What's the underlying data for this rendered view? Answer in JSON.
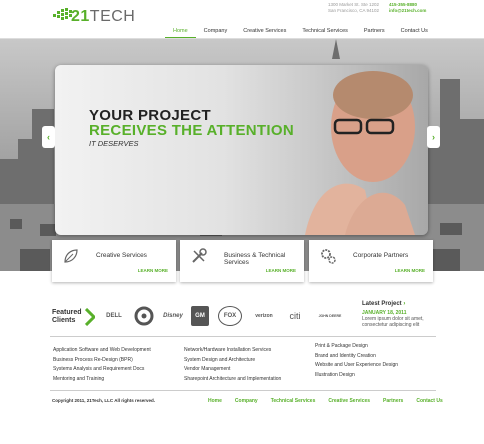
{
  "header": {
    "logo_prefix": "21",
    "logo_suffix": "TECH",
    "address_line1": "1300 Market St. Ste 1202",
    "address_line2": "San Francisco, CA 94102",
    "phone": "415-355-8880",
    "email": "info@21tech.com"
  },
  "nav": [
    "Home",
    "Company",
    "Creative Services",
    "Technical Services",
    "Partners",
    "Contact Us"
  ],
  "hero": {
    "headline1": "YOUR PROJECT",
    "headline2": "RECEIVES THE ATTENTION",
    "headline3": "IT DESERVES",
    "prev_arrow": "‹",
    "next_arrow": "›",
    "slide_count": 6,
    "active_slide": 1
  },
  "services": [
    {
      "title": "Creative Services",
      "more": "LEARN MORE"
    },
    {
      "title": "Business & Technical Services",
      "more": "LEARN MORE"
    },
    {
      "title": "Corporate Partners",
      "more": "LEARN MORE"
    }
  ],
  "clients": {
    "label_line1": "Featured",
    "label_line2": "Clients",
    "logos": [
      "DELL",
      "TARGET",
      "Disney",
      "GM",
      "FOX",
      "verizon",
      "citi",
      "JOHN DEERE"
    ]
  },
  "latest_project": {
    "title": "Latest Project",
    "date": "JANUARY 18, 2011",
    "text": "Lorem ipsum dolor sit amet, consectetur adipiscing elit"
  },
  "footer_columns": [
    [
      "Application Software and Web Development",
      "Business Process Re-Design (BPR)",
      "Systems Analysis and Requirement Docs",
      "Mentoring and Training"
    ],
    [
      "Network/Hardware Installation Services",
      "System Design and Architecture",
      "Vendor Management",
      "Sharepoint Architecture and Implementation"
    ],
    [
      "Print & Package Design",
      "Brand and Identity Creation",
      "Website and User Experience Design",
      "Illustration Design"
    ]
  ],
  "copyright": "Copyright 2011, 21Tech, LLC All rights reserved.",
  "footer_nav": [
    "Home",
    "Company",
    "Technical Services",
    "Creative Services",
    "Partners",
    "Contact Us"
  ],
  "colors": {
    "accent": "#58b02a",
    "text": "#333333"
  }
}
